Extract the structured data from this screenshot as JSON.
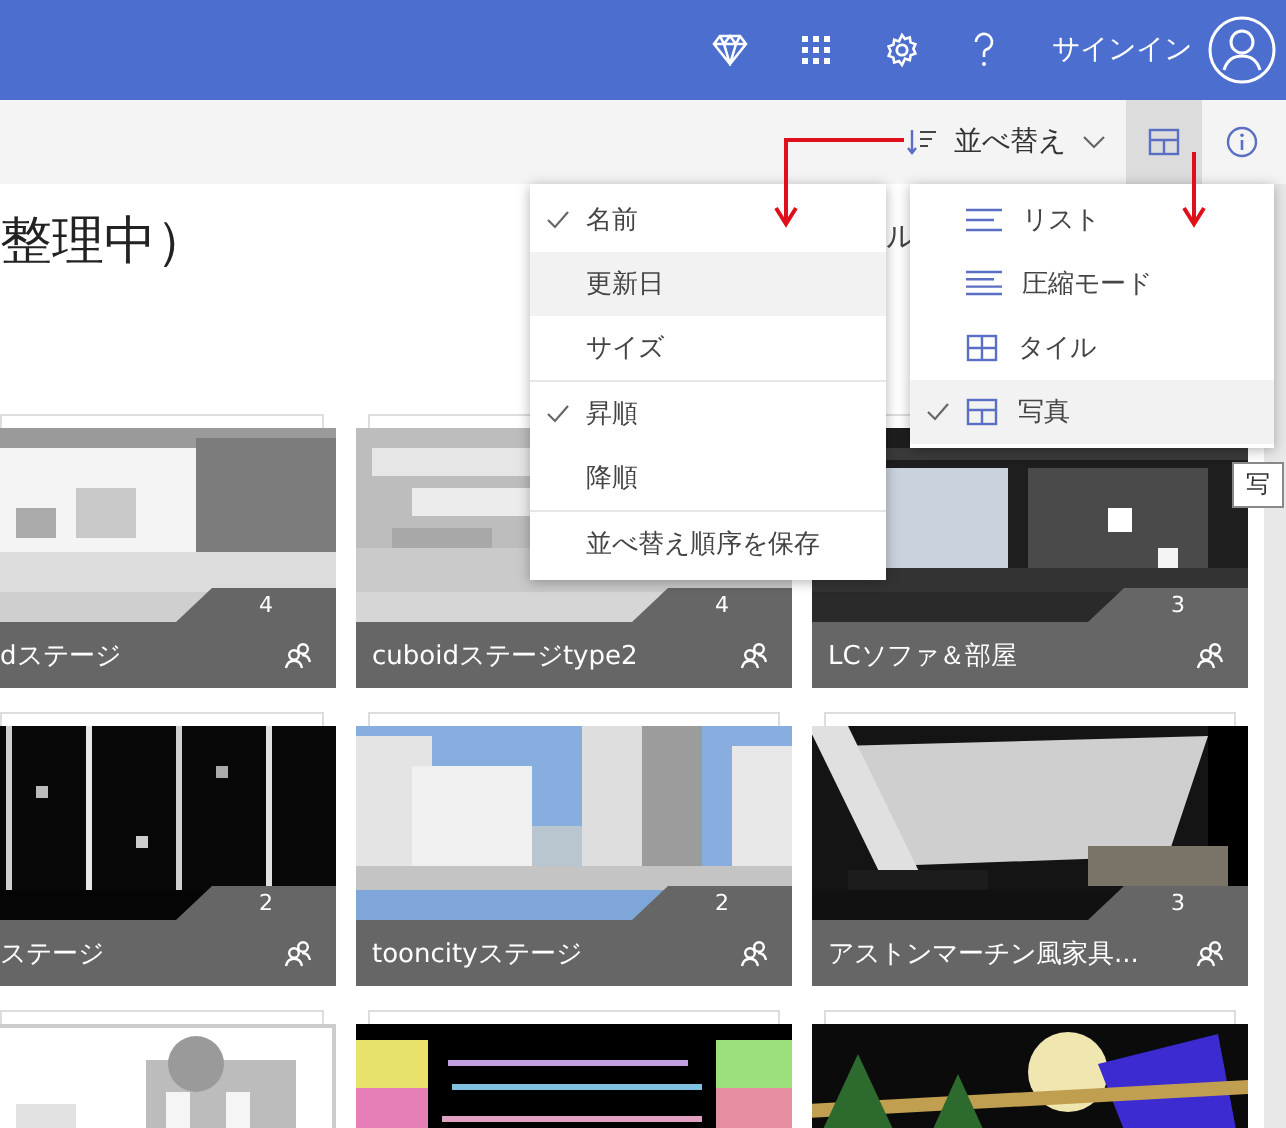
{
  "top_bar": {
    "sign_in": "サインイン"
  },
  "command_bar": {
    "sort_label": "並べ替え",
    "view_button_active": true
  },
  "page_title": "整理中）",
  "partly_hidden_text": "ル",
  "sort_menu": {
    "items": [
      {
        "kind": "option",
        "label": "名前",
        "checked": true,
        "highlighted": false
      },
      {
        "kind": "option",
        "label": "更新日",
        "checked": false,
        "highlighted": true
      },
      {
        "kind": "option",
        "label": "サイズ",
        "checked": false,
        "highlighted": false
      },
      {
        "kind": "divider"
      },
      {
        "kind": "option",
        "label": "昇順",
        "checked": true,
        "highlighted": false
      },
      {
        "kind": "option",
        "label": "降順",
        "checked": false,
        "highlighted": false
      },
      {
        "kind": "divider"
      },
      {
        "kind": "option",
        "label": "並べ替え順序を保存",
        "checked": false,
        "highlighted": false
      }
    ]
  },
  "view_menu": {
    "items": [
      {
        "kind": "list",
        "label": "リスト",
        "selected": false
      },
      {
        "kind": "compact",
        "label": "圧縮モード",
        "selected": false
      },
      {
        "kind": "tiles",
        "label": "タイル",
        "selected": false
      },
      {
        "kind": "photos",
        "label": "写真",
        "selected": true
      }
    ]
  },
  "tooltip": "写",
  "tiles": [
    {
      "kind": "captioned",
      "title": "dステージ",
      "count": "4"
    },
    {
      "kind": "captioned",
      "title": "cuboidステージtype2",
      "count": "4"
    },
    {
      "kind": "captioned",
      "title": "LCソファ＆部屋",
      "count": "3"
    },
    {
      "kind": "captioned",
      "title": "ステージ",
      "count": "2"
    },
    {
      "kind": "captioned",
      "title": "tooncityステージ",
      "count": "2"
    },
    {
      "kind": "captioned",
      "title": "アストンマーチン風家具...",
      "count": "3"
    },
    {
      "kind": "picture"
    },
    {
      "kind": "picture"
    },
    {
      "kind": "picture"
    }
  ]
}
